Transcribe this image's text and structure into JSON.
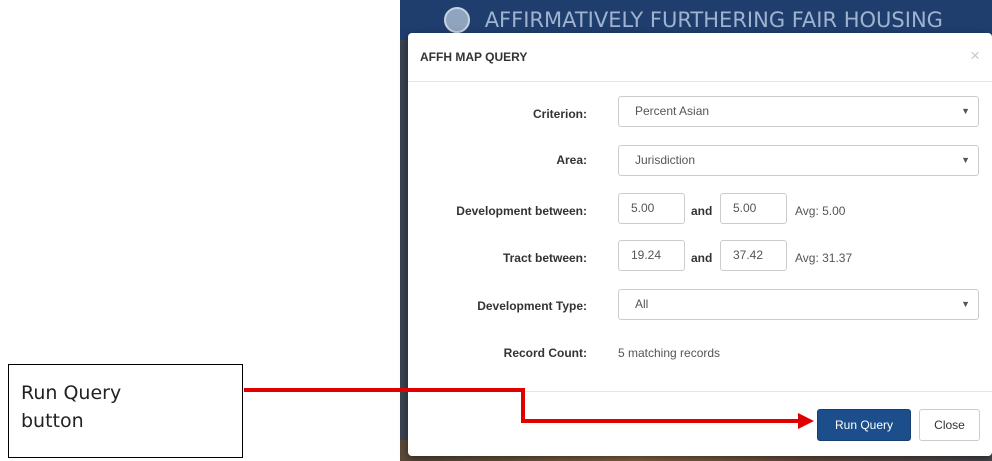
{
  "banner": {
    "title": "AFFIRMATIVELY FURTHERING FAIR HOUSING"
  },
  "modal": {
    "title": "AFFH MAP QUERY",
    "close_glyph": "×",
    "criterion": {
      "label": "Criterion:",
      "value": "Percent Asian"
    },
    "area": {
      "label": "Area:",
      "value": "Jurisdiction"
    },
    "development_between": {
      "label": "Development between:",
      "min": "5.00",
      "and": "and",
      "max": "5.00",
      "avg": "Avg: 5.00"
    },
    "tract_between": {
      "label": "Tract between:",
      "min": "19.24",
      "and": "and",
      "max": "37.42",
      "avg": "Avg: 31.37"
    },
    "development_type": {
      "label": "Development Type:",
      "value": "All"
    },
    "record_count": {
      "label": "Record Count:",
      "value": "5 matching records"
    },
    "buttons": {
      "run": "Run Query",
      "close": "Close"
    }
  },
  "callout": {
    "line1": "Run Query",
    "line2": "button"
  },
  "colors": {
    "primary_button": "#1b4e8b",
    "arrow": "#e00000",
    "banner": "#1f3e6e"
  },
  "icons": {
    "select_caret": "▼"
  }
}
